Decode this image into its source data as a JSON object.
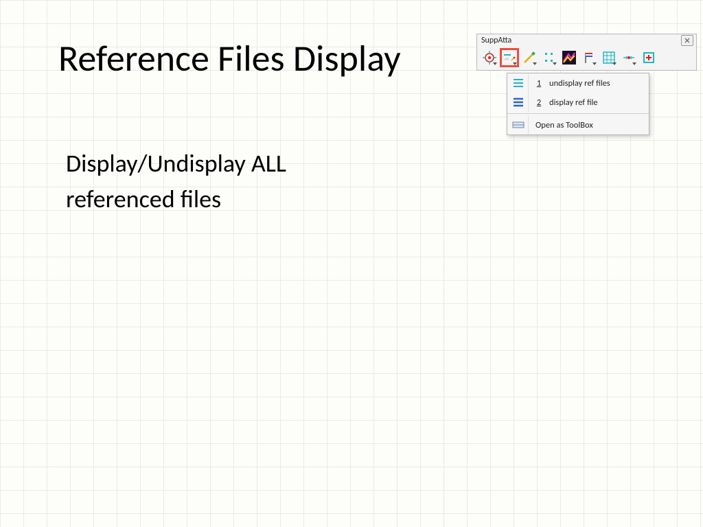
{
  "slide": {
    "title": "Reference Files Display",
    "body": "Display/Undisplay ALL referenced files"
  },
  "toolbar": {
    "title": "SuppAtta",
    "tools": {
      "t1": "target-icon",
      "t2": "ref-display-icon",
      "t3": "edit-line-icon",
      "t4": "nodes-icon",
      "t5": "layers-icon",
      "t6": "flag-icon",
      "t7": "grid-icon",
      "t8": "center-point-icon",
      "t9": "add-box-icon"
    }
  },
  "dropdown": {
    "item1_num": "1",
    "item1_label": "undisplay ref files",
    "item2_num": "2",
    "item2_label": "display ref file",
    "open_label": "Open as ToolBox"
  }
}
